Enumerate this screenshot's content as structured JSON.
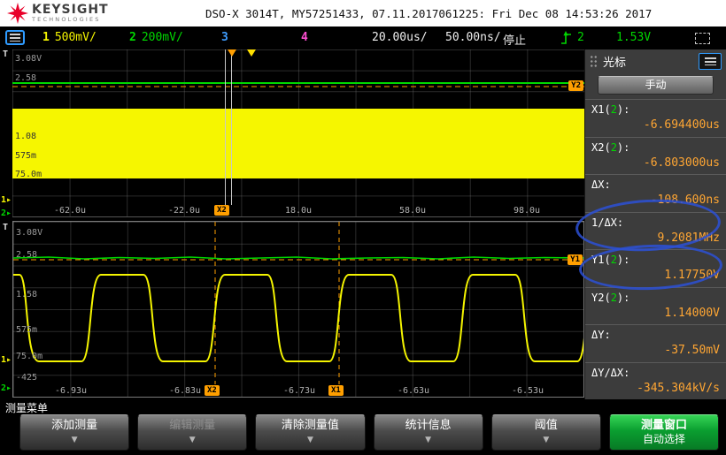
{
  "header": {
    "brand_name": "KEYSIGHT",
    "brand_sub": "TECHNOLOGIES",
    "title": "DSO-X 3014T, MY57251433, 07.11.2017061225: Fri Dec 08 14:53:26 2017"
  },
  "statusbar": {
    "ch1_num": "1",
    "ch1_scale": "500mV/",
    "ch2_num": "2",
    "ch2_scale": "200mV/",
    "ch3_num": "3",
    "ch4_num": "4",
    "main_timebase": "20.00us/",
    "zoom_timebase": "50.00ns/",
    "acq_state": "停止",
    "trig_source": "2",
    "trig_level": "1.53V"
  },
  "top_panel": {
    "y_labels": [
      "3.08V",
      "2.58",
      "1.08",
      "575m",
      "75.0m"
    ],
    "x_labels": [
      "-62.0u",
      "-22.0u",
      "18.0u",
      "58.0u",
      "98.0u"
    ],
    "x2_tag": "X2",
    "y2_tag": "Y2",
    "t_marker": "T",
    "ch1_marker": "1▸",
    "ch2_marker": "2▸"
  },
  "bottom_panel": {
    "y_labels": [
      "3.08V",
      "2.58",
      "1.58",
      "575m",
      "75.0m",
      "-425"
    ],
    "x_labels": [
      "-6.93u",
      "-6.83u",
      "-6.73u",
      "-6.63u",
      "-6.53u"
    ],
    "x1_tag": "X1",
    "x2_tag": "X2",
    "y1_tag": "Y1",
    "t_marker": "T",
    "ch1_marker": "1▸",
    "ch2_marker": "2▸"
  },
  "sidebar": {
    "title": "光标",
    "mode_button": "手动",
    "readouts": [
      {
        "pre": "X1(",
        "chan": "2",
        "post": "):",
        "value": "-6.694400us"
      },
      {
        "pre": "X2(",
        "chan": "2",
        "post": "):",
        "value": "-6.803000us"
      },
      {
        "pre": "ΔX:",
        "chan": "",
        "post": "",
        "value": "-108.600ns"
      },
      {
        "pre": "1/ΔX:",
        "chan": "",
        "post": "",
        "value": "9.2081MHz"
      },
      {
        "pre": "Y1(",
        "chan": "2",
        "post": "):",
        "value": "1.17750V"
      },
      {
        "pre": "Y2(",
        "chan": "2",
        "post": "):",
        "value": "1.14000V"
      },
      {
        "pre": "ΔY:",
        "chan": "",
        "post": "",
        "value": "-37.50mV"
      },
      {
        "pre": "ΔY/ΔX:",
        "chan": "",
        "post": "",
        "value": "-345.304kV/s"
      }
    ]
  },
  "menu": {
    "title": "测量菜单",
    "arrow_glyph": "▼",
    "buttons": [
      {
        "label": "添加测量"
      },
      {
        "label": "编辑测量"
      },
      {
        "label": "清除测量值"
      },
      {
        "label": "统计信息"
      },
      {
        "label": "阈值"
      },
      {
        "label": "测量窗口",
        "label2": "自动选择"
      }
    ]
  },
  "colors": {
    "ch1": "#f4f400",
    "ch2": "#00d800",
    "ch3": "#3f9dff",
    "ch4": "#ff4fd2",
    "cursor": "#ff9f00",
    "readout_value": "#ffa633",
    "annotation": "#2b50d6",
    "softkey_active": "#0a9e30"
  }
}
